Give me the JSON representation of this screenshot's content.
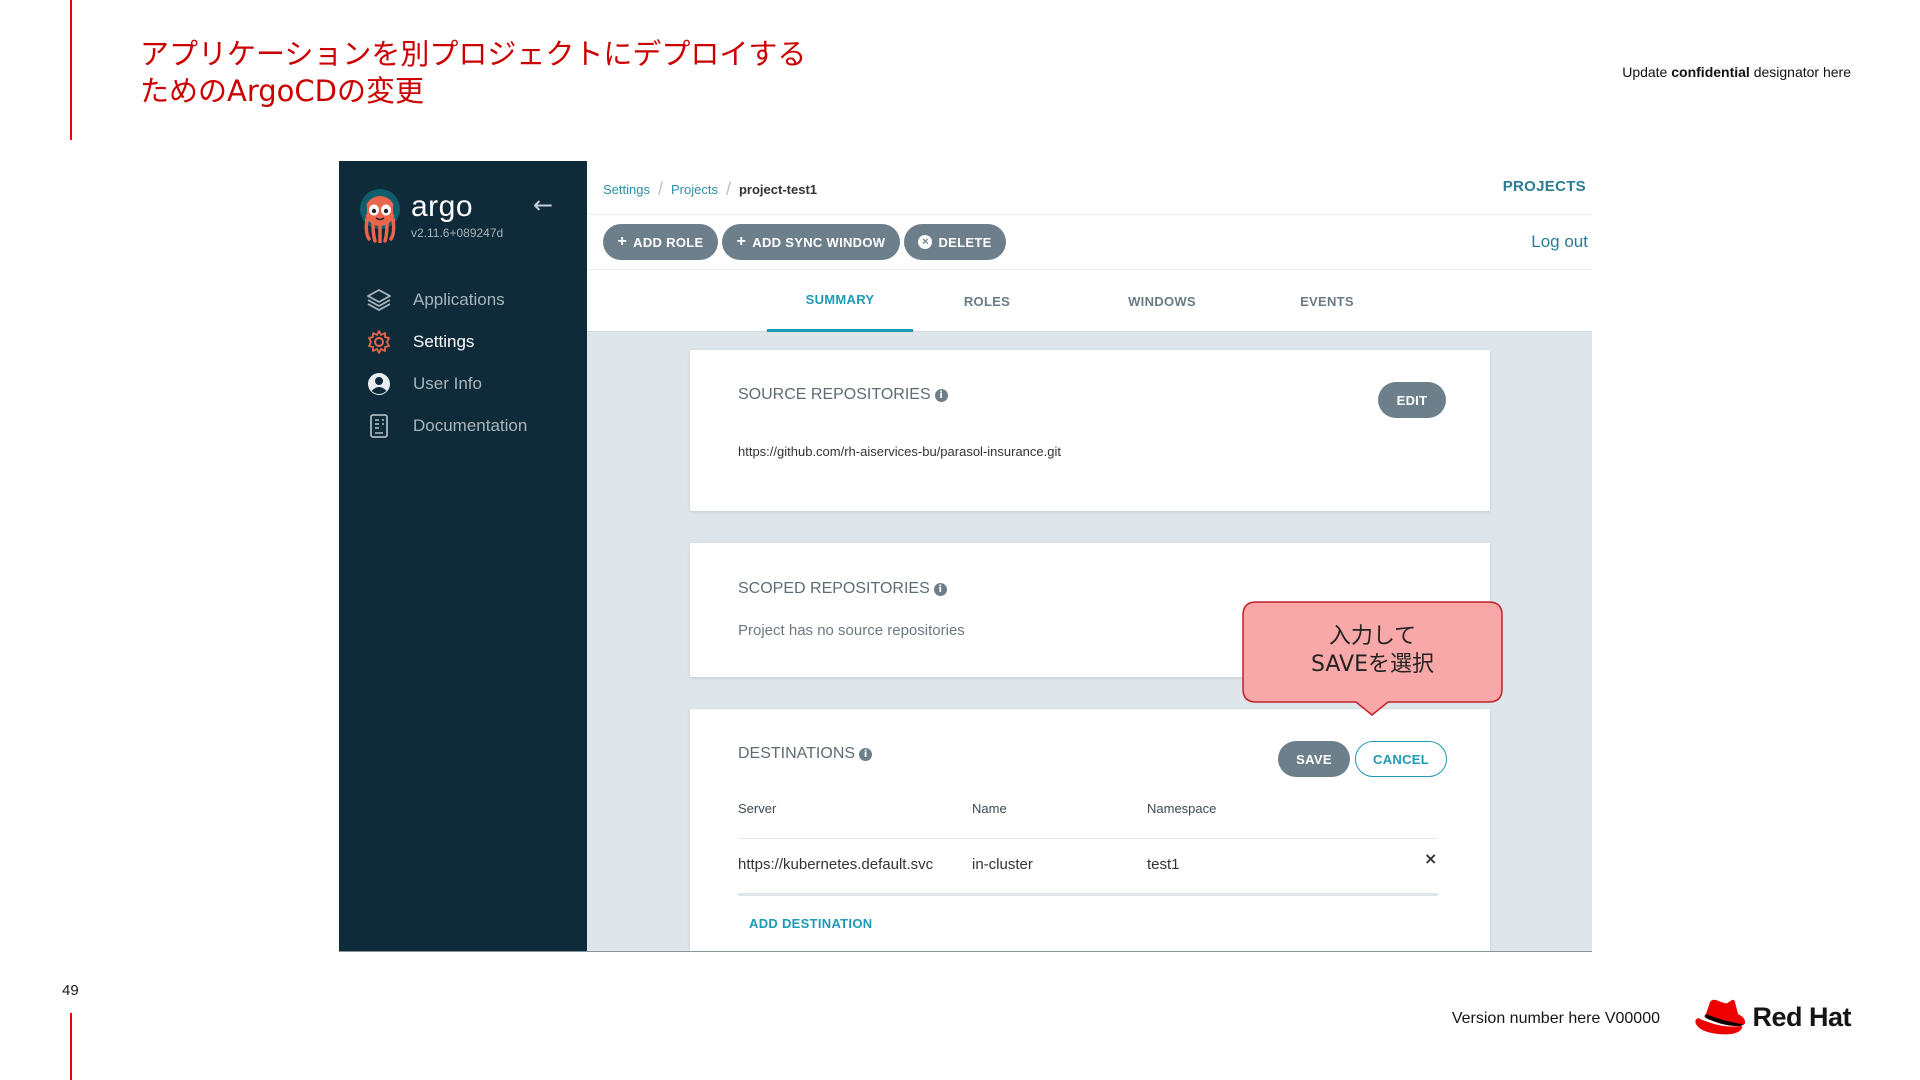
{
  "slide": {
    "title_line1": "アプリケーションを別プロジェクトにデプロイする",
    "title_line2": "ためのArgoCDの変更",
    "confidential_prefix": "Update ",
    "confidential_bold": "confidential",
    "confidential_suffix": " designator here",
    "page_number": "49",
    "version": "Version number here V00000",
    "brand": "Red Hat",
    "accent_color": "#ee0000"
  },
  "sidebar": {
    "app_name": "argo",
    "version": "v2.11.6+089247d",
    "items": [
      {
        "label": "Applications",
        "icon": "layers-icon",
        "active": false
      },
      {
        "label": "Settings",
        "icon": "gear-icon",
        "active": true
      },
      {
        "label": "User Info",
        "icon": "user-circle-icon",
        "active": false
      },
      {
        "label": "Documentation",
        "icon": "book-icon",
        "active": false
      }
    ]
  },
  "header": {
    "breadcrumb": [
      "Settings",
      "Projects",
      "project-test1"
    ],
    "projects_link": "PROJECTS",
    "logout": "Log out"
  },
  "toolbar": {
    "add_role": "ADD ROLE",
    "add_sync_window": "ADD SYNC WINDOW",
    "delete": "DELETE"
  },
  "tabs": [
    {
      "label": "SUMMARY",
      "active": true
    },
    {
      "label": "ROLES",
      "active": false
    },
    {
      "label": "WINDOWS",
      "active": false
    },
    {
      "label": "EVENTS",
      "active": false
    }
  ],
  "source_repositories": {
    "title": "SOURCE REPOSITORIES",
    "edit": "EDIT",
    "url": "https://github.com/rh-aiservices-bu/parasol-insurance.git"
  },
  "scoped_repositories": {
    "title": "SCOPED REPOSITORIES",
    "empty": "Project has no source repositories"
  },
  "destinations": {
    "title": "DESTINATIONS",
    "save": "SAVE",
    "cancel": "CANCEL",
    "columns": [
      "Server",
      "Name",
      "Namespace"
    ],
    "rows": [
      {
        "server": "https://kubernetes.default.svc",
        "name": "in-cluster",
        "namespace": "test1"
      }
    ],
    "add": "ADD DESTINATION"
  },
  "callout": {
    "line1": "入力して",
    "line2": "SAVEを選択",
    "fill": "#f8a8a8",
    "stroke": "#c0202a"
  }
}
